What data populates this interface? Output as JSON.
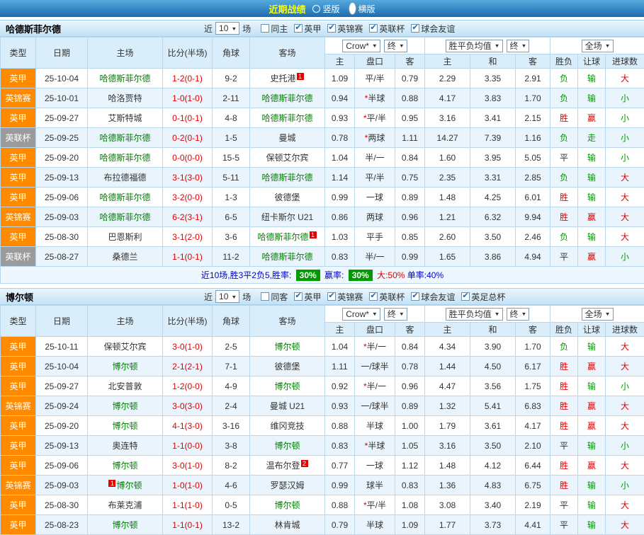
{
  "topbar": {
    "title": "近期战绩",
    "options": [
      {
        "label": "竖版",
        "selected": false
      },
      {
        "label": "横版",
        "selected": true
      }
    ]
  },
  "colors": {
    "league_orange": "#ff8a00",
    "league_gray": "#9b9b9b",
    "focus_green": "#008000",
    "normal_team": "#333333",
    "score_red": "#dd0000",
    "win_red": "#dd0000",
    "lose_green": "#009900",
    "draw_dark": "#333333",
    "badge_red": "#e60000",
    "rate_badge_bg": "#009900"
  },
  "columns": {
    "type": "类型",
    "date": "日期",
    "home": "主场",
    "score": "比分(半场)",
    "corner": "角球",
    "away": "客场",
    "odds_home": "主",
    "odds_handicap": "盘口",
    "odds_away": "客",
    "avg_home": "主",
    "avg_draw": "和",
    "avg_away": "客",
    "result": "胜负",
    "handicap_result": "让球",
    "goals": "进球数"
  },
  "sections": [
    {
      "team": "哈德斯菲尔德",
      "near": {
        "label": "近",
        "count": "10",
        "suffix": "场"
      },
      "checkboxes": [
        {
          "label": "同主",
          "checked": false
        },
        {
          "label": "英甲",
          "checked": true
        },
        {
          "label": "英锦赛",
          "checked": true
        },
        {
          "label": "英联杯",
          "checked": true
        },
        {
          "label": "球会友谊",
          "checked": true
        }
      ],
      "filters": {
        "company": "Crow*",
        "company_period": "终",
        "avg": "胜平负均值",
        "avg_period": "终",
        "scope": "全场"
      },
      "rows": [
        {
          "league": "英甲",
          "date": "25-10-04",
          "home": {
            "name": "哈德斯菲尔德",
            "focus": true
          },
          "score": "1-2(0-1)",
          "corner": "9-2",
          "away": {
            "name": "史托港",
            "badge": "1",
            "badge_pos": "after"
          },
          "odds": [
            "1.09",
            "平/半",
            "0.79"
          ],
          "avg": [
            "2.29",
            "3.35",
            "2.91"
          ],
          "result": "负",
          "let": "输",
          "goals": "大"
        },
        {
          "league": "英锦赛",
          "date": "25-10-01",
          "home": {
            "name": "哈洛贾特"
          },
          "score": "1-0(1-0)",
          "corner": "2-11",
          "away": {
            "name": "哈德斯菲尔德",
            "focus": true
          },
          "odds": [
            "0.94",
            "*半球",
            "0.88"
          ],
          "avg": [
            "4.17",
            "3.83",
            "1.70"
          ],
          "result": "负",
          "let": "输",
          "goals": "小"
        },
        {
          "league": "英甲",
          "date": "25-09-27",
          "home": {
            "name": "艾斯特城"
          },
          "score": "0-1(0-1)",
          "corner": "4-8",
          "away": {
            "name": "哈德斯菲尔德",
            "focus": true
          },
          "odds": [
            "0.93",
            "*平/半",
            "0.95"
          ],
          "avg": [
            "3.16",
            "3.41",
            "2.15"
          ],
          "result": "胜",
          "let": "赢",
          "goals": "小"
        },
        {
          "league": "英联杯",
          "date": "25-09-25",
          "home": {
            "name": "哈德斯菲尔德",
            "focus": true
          },
          "score": "0-2(0-1)",
          "corner": "1-5",
          "away": {
            "name": "曼城"
          },
          "odds": [
            "0.78",
            "*两球",
            "1.11"
          ],
          "avg": [
            "14.27",
            "7.39",
            "1.16"
          ],
          "result": "负",
          "let": "走",
          "goals": "小"
        },
        {
          "league": "英甲",
          "date": "25-09-20",
          "home": {
            "name": "哈德斯菲尔德",
            "focus": true
          },
          "score": "0-0(0-0)",
          "corner": "15-5",
          "away": {
            "name": "保顿艾尔宾"
          },
          "odds": [
            "1.04",
            "半/一",
            "0.84"
          ],
          "avg": [
            "1.60",
            "3.95",
            "5.05"
          ],
          "result": "平",
          "let": "输",
          "goals": "小"
        },
        {
          "league": "英甲",
          "date": "25-09-13",
          "home": {
            "name": "布拉德福德"
          },
          "score": "3-1(3-0)",
          "corner": "5-11",
          "away": {
            "name": "哈德斯菲尔德",
            "focus": true
          },
          "odds": [
            "1.14",
            "平/半",
            "0.75"
          ],
          "avg": [
            "2.35",
            "3.31",
            "2.85"
          ],
          "result": "负",
          "let": "输",
          "goals": "大"
        },
        {
          "league": "英甲",
          "date": "25-09-06",
          "home": {
            "name": "哈德斯菲尔德",
            "focus": true
          },
          "score": "3-2(0-0)",
          "corner": "1-3",
          "away": {
            "name": "彼德堡"
          },
          "odds": [
            "0.99",
            "一球",
            "0.89"
          ],
          "avg": [
            "1.48",
            "4.25",
            "6.01"
          ],
          "result": "胜",
          "let": "输",
          "goals": "大"
        },
        {
          "league": "英锦赛",
          "date": "25-09-03",
          "home": {
            "name": "哈德斯菲尔德",
            "focus": true
          },
          "score": "6-2(3-1)",
          "corner": "6-5",
          "away": {
            "name": "纽卡斯尔 U21"
          },
          "odds": [
            "0.86",
            "两球",
            "0.96"
          ],
          "avg": [
            "1.21",
            "6.32",
            "9.94"
          ],
          "result": "胜",
          "let": "赢",
          "goals": "大"
        },
        {
          "league": "英甲",
          "date": "25-08-30",
          "home": {
            "name": "巴恩斯利"
          },
          "score": "3-1(2-0)",
          "corner": "3-6",
          "away": {
            "name": "哈德斯菲尔德",
            "focus": true,
            "badge": "1",
            "badge_pos": "after"
          },
          "odds": [
            "1.03",
            "平手",
            "0.85"
          ],
          "avg": [
            "2.60",
            "3.50",
            "2.46"
          ],
          "result": "负",
          "let": "输",
          "goals": "大"
        },
        {
          "league": "英联杯",
          "date": "25-08-27",
          "home": {
            "name": "桑德兰"
          },
          "score": "1-1(0-1)",
          "corner": "11-2",
          "away": {
            "name": "哈德斯菲尔德",
            "focus": true
          },
          "odds": [
            "0.83",
            "半/一",
            "0.99"
          ],
          "avg": [
            "1.65",
            "3.86",
            "4.94"
          ],
          "result": "平",
          "let": "赢",
          "goals": "小"
        }
      ],
      "summary": {
        "prefix": "近10场,胜3平2负5,胜率:",
        "win_rate": "30%",
        "earn_label": "赢率:",
        "earn_rate": "30%",
        "big": "大:50%",
        "single": "单率:40%"
      }
    },
    {
      "team": "博尔顿",
      "near": {
        "label": "近",
        "count": "10",
        "suffix": "场"
      },
      "checkboxes": [
        {
          "label": "同客",
          "checked": false
        },
        {
          "label": "英甲",
          "checked": true
        },
        {
          "label": "英锦赛",
          "checked": true
        },
        {
          "label": "英联杯",
          "checked": true
        },
        {
          "label": "球会友谊",
          "checked": true
        },
        {
          "label": "英足总杯",
          "checked": true
        }
      ],
      "filters": {
        "company": "Crow*",
        "company_period": "终",
        "avg": "胜平负均值",
        "avg_period": "终",
        "scope": "全场"
      },
      "rows": [
        {
          "league": "英甲",
          "date": "25-10-11",
          "home": {
            "name": "保顿艾尔宾"
          },
          "score": "3-0(1-0)",
          "corner": "2-5",
          "away": {
            "name": "博尔顿",
            "focus": true
          },
          "odds": [
            "1.04",
            "*半/一",
            "0.84"
          ],
          "avg": [
            "4.34",
            "3.90",
            "1.70"
          ],
          "result": "负",
          "let": "输",
          "goals": "大"
        },
        {
          "league": "英甲",
          "date": "25-10-04",
          "home": {
            "name": "博尔顿",
            "focus": true
          },
          "score": "2-1(2-1)",
          "corner": "7-1",
          "away": {
            "name": "彼德堡"
          },
          "odds": [
            "1.11",
            "一/球半",
            "0.78"
          ],
          "avg": [
            "1.44",
            "4.50",
            "6.17"
          ],
          "result": "胜",
          "let": "赢",
          "goals": "大"
        },
        {
          "league": "英甲",
          "date": "25-09-27",
          "home": {
            "name": "北安普敦"
          },
          "score": "1-2(0-0)",
          "corner": "4-9",
          "away": {
            "name": "博尔顿",
            "focus": true
          },
          "odds": [
            "0.92",
            "*半/一",
            "0.96"
          ],
          "avg": [
            "4.47",
            "3.56",
            "1.75"
          ],
          "result": "胜",
          "let": "输",
          "goals": "小"
        },
        {
          "league": "英锦赛",
          "date": "25-09-24",
          "home": {
            "name": "博尔顿",
            "focus": true
          },
          "score": "3-0(3-0)",
          "corner": "2-4",
          "away": {
            "name": "曼城 U21"
          },
          "odds": [
            "0.93",
            "一/球半",
            "0.89"
          ],
          "avg": [
            "1.32",
            "5.41",
            "6.83"
          ],
          "result": "胜",
          "let": "赢",
          "goals": "大"
        },
        {
          "league": "英甲",
          "date": "25-09-20",
          "home": {
            "name": "博尔顿",
            "focus": true
          },
          "score": "4-1(3-0)",
          "corner": "3-16",
          "away": {
            "name": "维冈竞技"
          },
          "odds": [
            "0.88",
            "半球",
            "1.00"
          ],
          "avg": [
            "1.79",
            "3.61",
            "4.17"
          ],
          "result": "胜",
          "let": "赢",
          "goals": "大"
        },
        {
          "league": "英甲",
          "date": "25-09-13",
          "home": {
            "name": "奥连特"
          },
          "score": "1-1(0-0)",
          "corner": "3-8",
          "away": {
            "name": "博尔顿",
            "focus": true
          },
          "odds": [
            "0.83",
            "*半球",
            "1.05"
          ],
          "avg": [
            "3.16",
            "3.50",
            "2.10"
          ],
          "result": "平",
          "let": "输",
          "goals": "小"
        },
        {
          "league": "英甲",
          "date": "25-09-06",
          "home": {
            "name": "博尔顿",
            "focus": true
          },
          "score": "3-0(1-0)",
          "corner": "8-2",
          "away": {
            "name": "温布尔登",
            "badge": "2",
            "badge_pos": "after"
          },
          "odds": [
            "0.77",
            "一球",
            "1.12"
          ],
          "avg": [
            "1.48",
            "4.12",
            "6.44"
          ],
          "result": "胜",
          "let": "赢",
          "goals": "大"
        },
        {
          "league": "英锦赛",
          "date": "25-09-03",
          "home": {
            "name": "博尔顿",
            "focus": true,
            "badge": "1",
            "badge_pos": "before"
          },
          "score": "1-0(1-0)",
          "corner": "4-6",
          "away": {
            "name": "罗瑟汉姆"
          },
          "odds": [
            "0.99",
            "球半",
            "0.83"
          ],
          "avg": [
            "1.36",
            "4.83",
            "6.75"
          ],
          "result": "胜",
          "let": "输",
          "goals": "小"
        },
        {
          "league": "英甲",
          "date": "25-08-30",
          "home": {
            "name": "布莱克浦"
          },
          "score": "1-1(1-0)",
          "corner": "0-5",
          "away": {
            "name": "博尔顿",
            "focus": true
          },
          "odds": [
            "0.88",
            "*平/半",
            "1.08"
          ],
          "avg": [
            "3.08",
            "3.40",
            "2.19"
          ],
          "result": "平",
          "let": "输",
          "goals": "大"
        },
        {
          "league": "英甲",
          "date": "25-08-23",
          "home": {
            "name": "博尔顿",
            "focus": true
          },
          "score": "1-1(0-1)",
          "corner": "13-2",
          "away": {
            "name": "林肯城"
          },
          "odds": [
            "0.79",
            "半球",
            "1.09"
          ],
          "avg": [
            "1.77",
            "3.73",
            "4.41"
          ],
          "result": "平",
          "let": "输",
          "goals": "大"
        }
      ],
      "summary": null
    }
  ]
}
